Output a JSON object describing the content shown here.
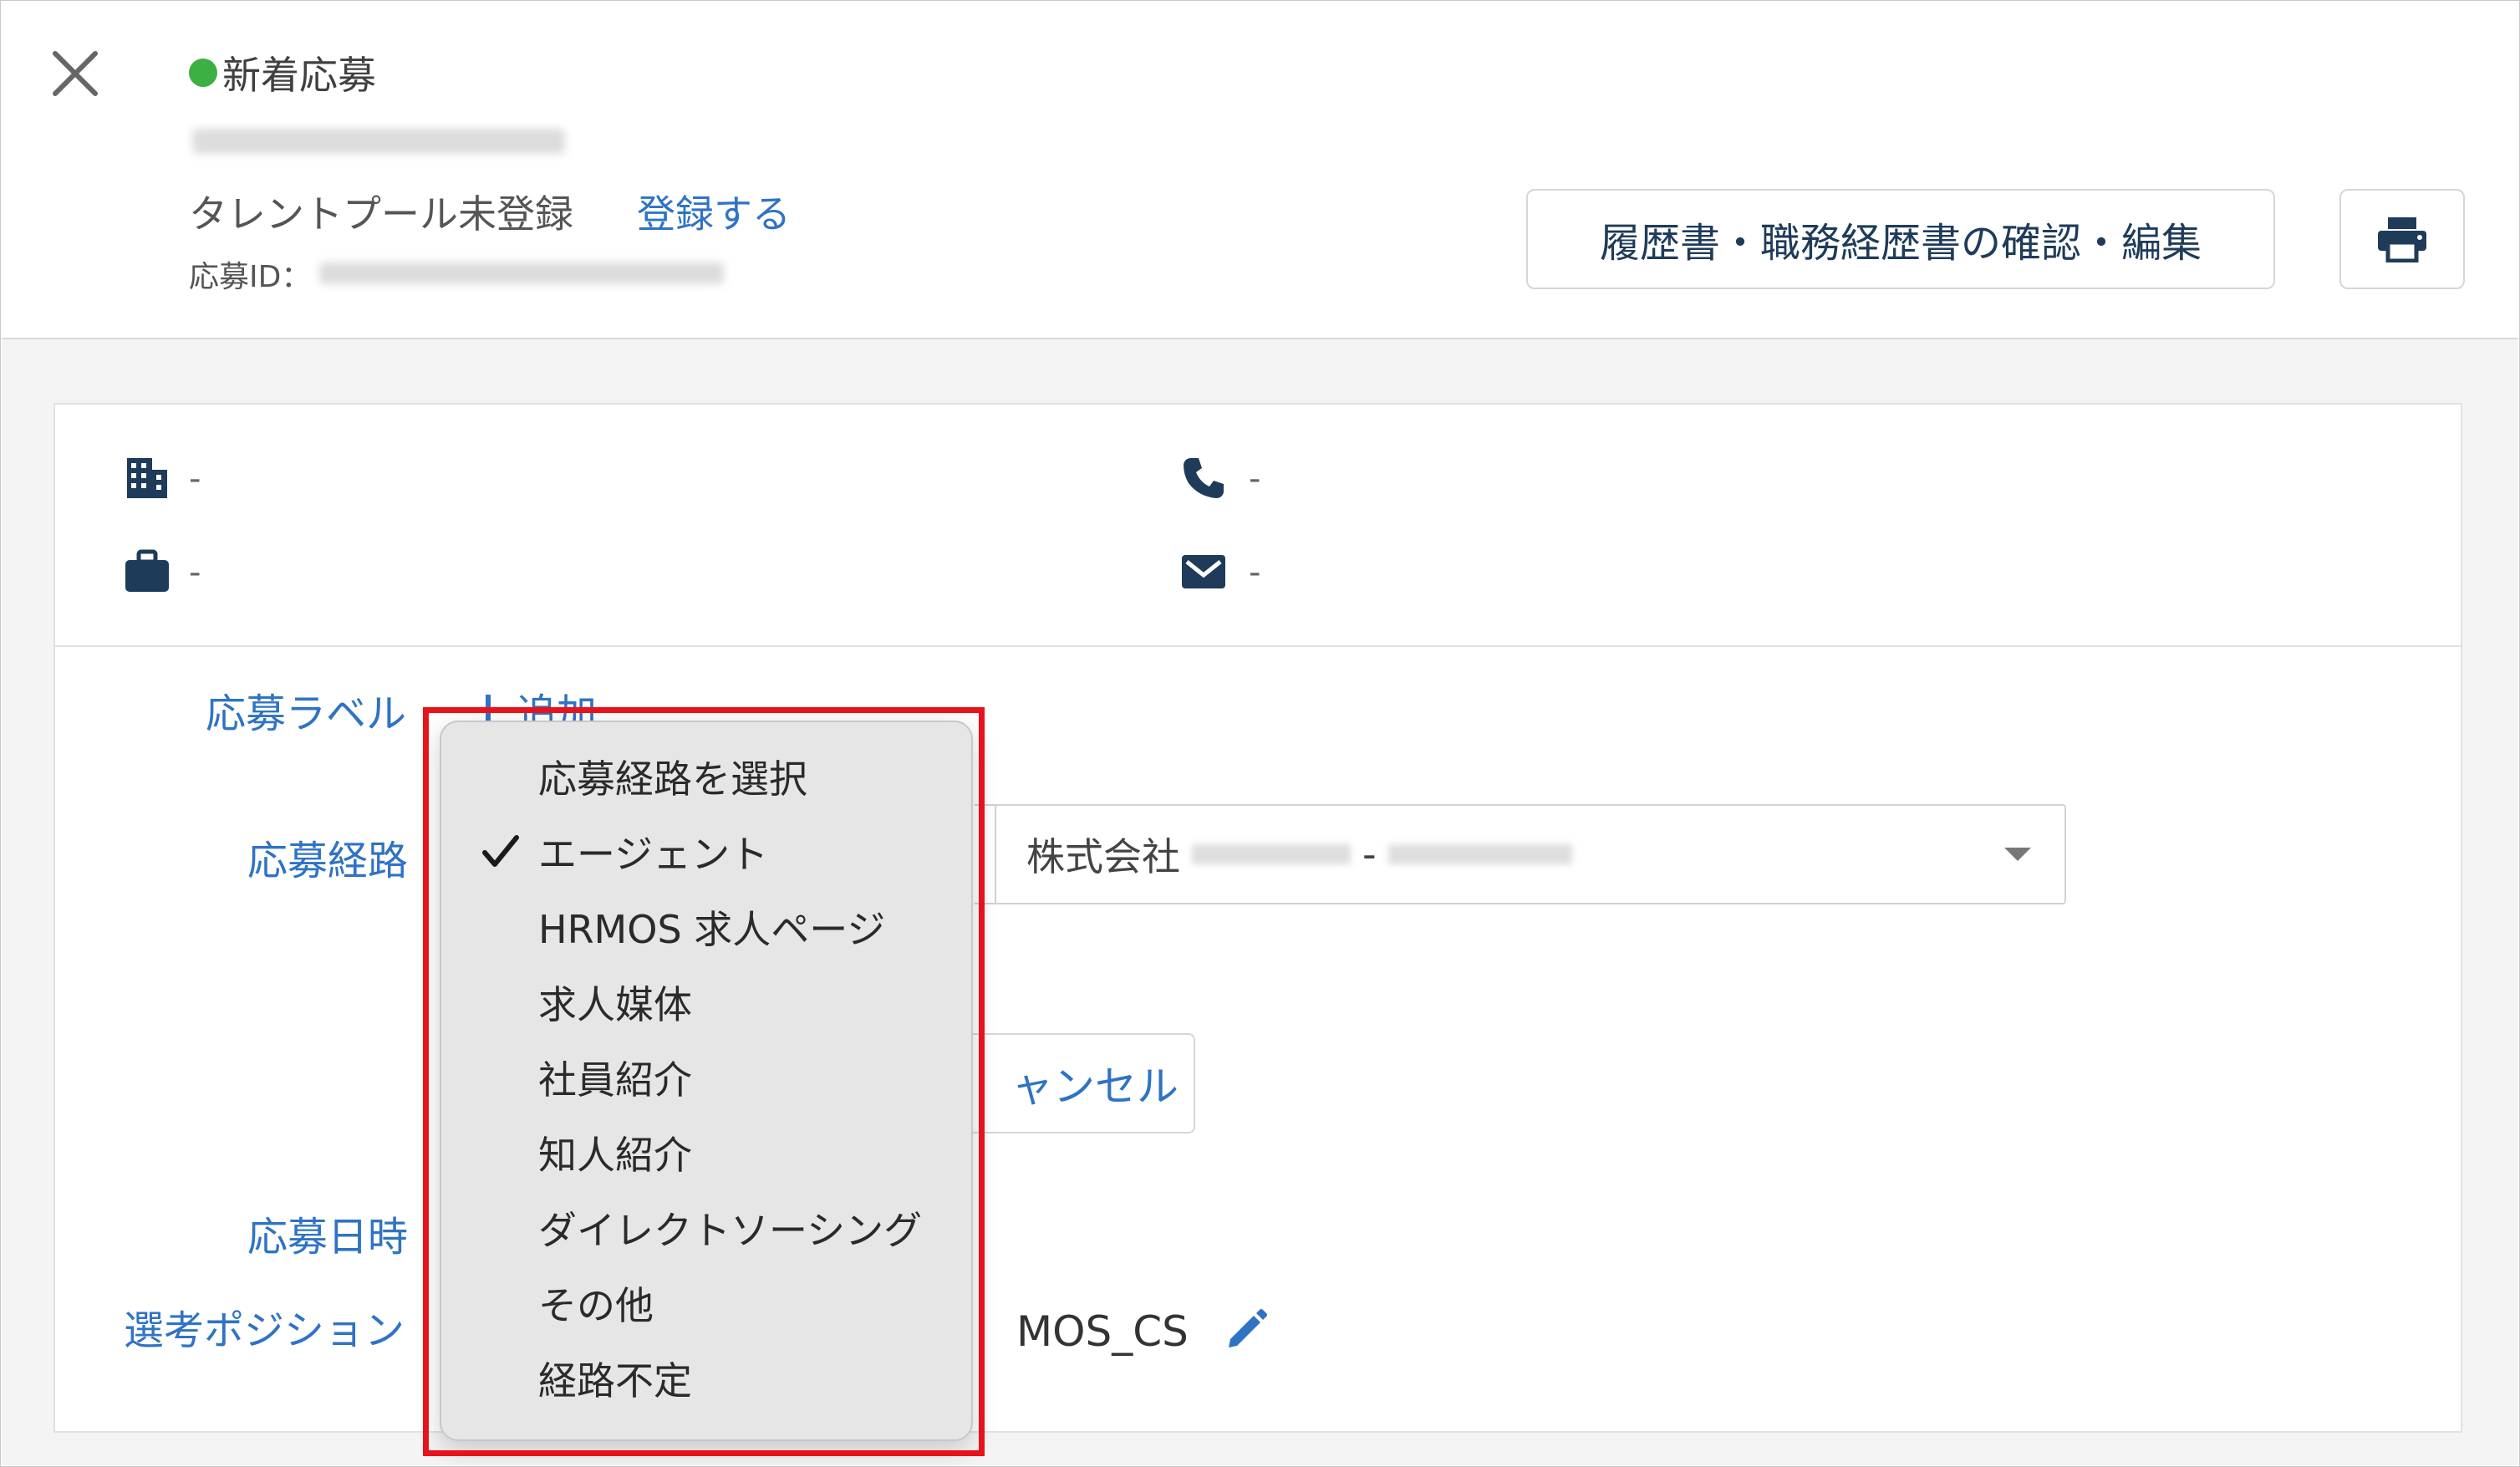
{
  "header": {
    "status": "新着応募",
    "talent_pool": "タレントプール未登録",
    "register_link": "登録する",
    "app_id_label": "応募ID：",
    "resume_button": "履歴書・職務経歴書の確認・編集"
  },
  "contact": {
    "company": "-",
    "phone": "-",
    "job": "-",
    "email": "-"
  },
  "fields": {
    "label_label": "応募ラベル",
    "add_label": "追加",
    "route_label": "応募経路",
    "company_value_prefix": "株式会社",
    "company_value_sep": "-",
    "cancel_label": "ャンセル",
    "date_label": "応募日時",
    "position_label": "選考ポジション",
    "position_value": "MOS_CS"
  },
  "dropdown": {
    "items": [
      {
        "label": "応募経路を選択",
        "checked": false
      },
      {
        "label": "エージェント",
        "checked": true
      },
      {
        "label": "HRMOS 求人ページ",
        "checked": false
      },
      {
        "label": "求人媒体",
        "checked": false
      },
      {
        "label": "社員紹介",
        "checked": false
      },
      {
        "label": "知人紹介",
        "checked": false
      },
      {
        "label": "ダイレクトソーシング",
        "checked": false
      },
      {
        "label": "その他",
        "checked": false
      },
      {
        "label": "経路不定",
        "checked": false
      }
    ]
  },
  "colors": {
    "status_green": "#3cb043",
    "link_blue": "#2f73c4",
    "icon_navy": "#1f3b5a",
    "highlight_red": "#e8121a"
  }
}
